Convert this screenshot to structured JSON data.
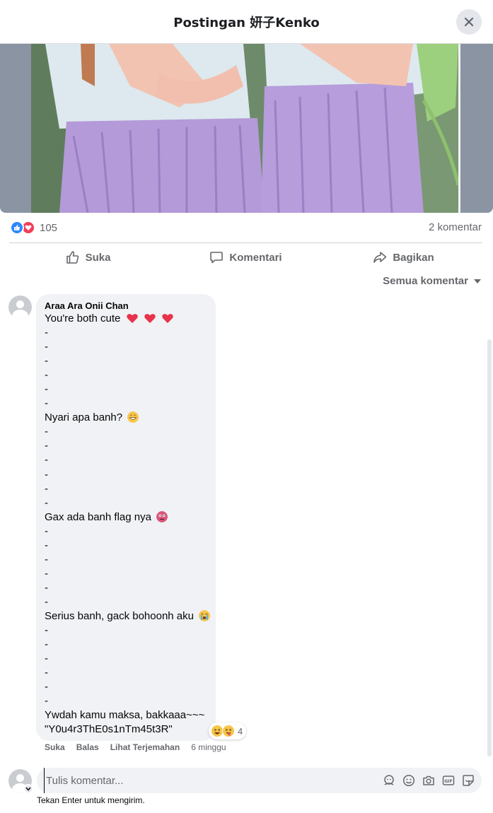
{
  "header": {
    "title": "Postingan 妍子Kenko"
  },
  "post": {
    "reaction_count": "105",
    "comment_count": "2 komentar",
    "actions": {
      "like": "Suka",
      "comment": "Komentari",
      "share": "Bagikan"
    },
    "sort_label": "Semua komentar"
  },
  "comment": {
    "author": "Araa Ara Onii Chan",
    "lines": [
      "You're both cute",
      "-",
      "-",
      "-",
      "-",
      "-",
      "-",
      "Nyari apa banh?",
      "-",
      "-",
      "-",
      "-",
      "-",
      "-",
      "Gax ada banh flag nya",
      "-",
      "-",
      "-",
      "-",
      "-",
      "-",
      "Serius banh, gack bohoonh aku",
      "-",
      "-",
      "-",
      "-",
      "-",
      "-",
      "Ywdah kamu maksa, bakkaaa~~~",
      "\"Y0u4r3ThE0s1nTm45t3R\""
    ],
    "reaction_count": "4",
    "meta": {
      "like": "Suka",
      "reply": "Balas",
      "translate": "Lihat Terjemahan",
      "time": "6 minggu"
    }
  },
  "composer": {
    "placeholder": "Tulis komentar...",
    "hint": "Tekan Enter untuk mengirim."
  },
  "colors": {
    "like_blue": "#2d88ff",
    "love_red": "#f33e58",
    "bubble_bg": "#f0f2f5",
    "muted_text": "#65676b"
  }
}
